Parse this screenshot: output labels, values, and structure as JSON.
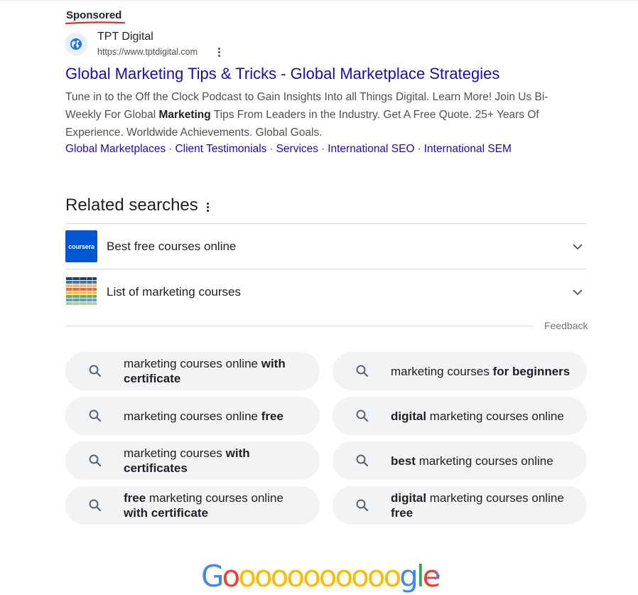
{
  "ad": {
    "label": "Sponsored",
    "advertiser_name": "TPT Digital",
    "advertiser_url": "https://www.tptdigital.com",
    "title": "Global Marketing Tips & Tricks - Global Marketplace Strategies",
    "description_before": "Tune in to the Off the Clock Podcast to Gain Insights Into all Things Digital. Learn More! Join Us Bi-Weekly For Global ",
    "description_bold": "Marketing",
    "description_after": " Tips From Leaders in the Industry. Get A Free Quote. 25+ Years Of Experience. Worldwide Achievements. Global Goals.",
    "sitelinks": [
      "Global Marketplaces",
      "Client Testimonials",
      "Services",
      "International SEO",
      "International SEM"
    ],
    "sitelink_separator": "·"
  },
  "related": {
    "title": "Related searches",
    "expandable": [
      {
        "label": "Best free courses online",
        "thumb_text": "coursera"
      },
      {
        "label": "List of marketing courses"
      }
    ],
    "feedback_label": "Feedback",
    "chips": [
      {
        "parts": [
          {
            "t": "marketing courses online ",
            "b": false
          },
          {
            "t": "with certificate",
            "b": true
          }
        ]
      },
      {
        "parts": [
          {
            "t": "marketing courses ",
            "b": false
          },
          {
            "t": "for beginners",
            "b": true
          }
        ]
      },
      {
        "parts": [
          {
            "t": "marketing courses online ",
            "b": false
          },
          {
            "t": "free",
            "b": true
          }
        ]
      },
      {
        "parts": [
          {
            "t": "digital",
            "b": true
          },
          {
            "t": " marketing courses online",
            "b": false
          }
        ]
      },
      {
        "parts": [
          {
            "t": "marketing courses ",
            "b": false
          },
          {
            "t": "with certificates",
            "b": true
          }
        ]
      },
      {
        "parts": [
          {
            "t": "best",
            "b": true
          },
          {
            "t": " marketing courses online",
            "b": false
          }
        ]
      },
      {
        "parts": [
          {
            "t": "free",
            "b": true
          },
          {
            "t": " marketing courses online ",
            "b": false
          },
          {
            "t": "with certificate",
            "b": true
          }
        ]
      },
      {
        "parts": [
          {
            "t": "digital",
            "b": true
          },
          {
            "t": " marketing courses online ",
            "b": false
          },
          {
            "t": "free",
            "b": true
          }
        ]
      }
    ]
  },
  "pagination": {
    "logo_start": "G",
    "logo_o_count": 11,
    "logo_end_g": "g",
    "logo_end_l": "l",
    "logo_end_e": "e",
    "next_icon": "chevron-right-icon"
  },
  "colors": {
    "link": "#1a0dab",
    "chip_bg": "#f1f3f4",
    "coursera_blue": "#0056d2",
    "sponsored_underline": "#d93025"
  }
}
